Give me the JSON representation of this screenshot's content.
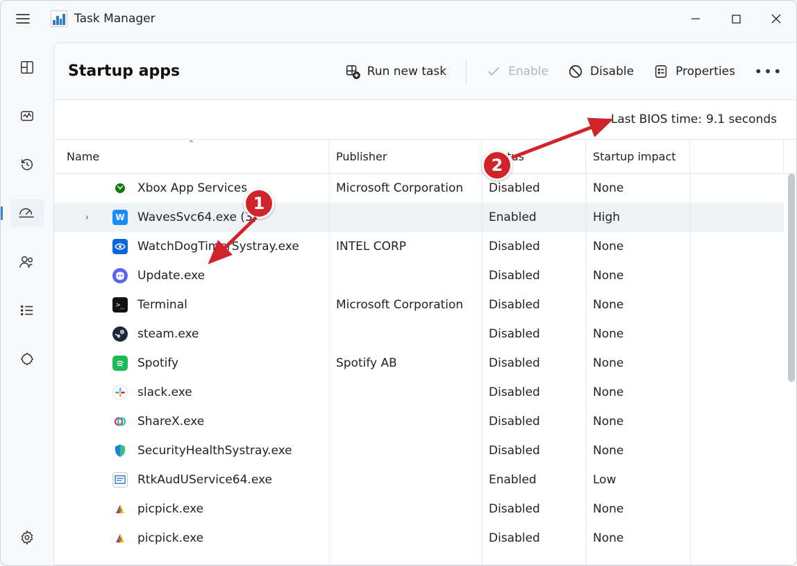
{
  "app": {
    "title": "Task Manager"
  },
  "page": {
    "title": "Startup apps"
  },
  "toolbar": {
    "run_new_task": "Run new task",
    "enable": "Enable",
    "disable": "Disable",
    "properties": "Properties"
  },
  "bios": {
    "label": "Last BIOS time:",
    "value": "9.1 seconds"
  },
  "columns": {
    "name": "Name",
    "publisher": "Publisher",
    "status": "Status",
    "impact": "Startup impact"
  },
  "rows": [
    {
      "name": "Xbox App Services",
      "publisher": "Microsoft Corporation",
      "status": "Disabled",
      "impact": "None",
      "icon": "xbox",
      "expandable": false
    },
    {
      "name": "WavesSvc64.exe (3)",
      "publisher": "",
      "status": "Enabled",
      "impact": "High",
      "icon": "waves",
      "expandable": true,
      "selected": true
    },
    {
      "name": "WatchDogTimerSystray.exe",
      "publisher": "INTEL CORP",
      "status": "Disabled",
      "impact": "None",
      "icon": "eye",
      "expandable": false
    },
    {
      "name": "Update.exe",
      "publisher": "",
      "status": "Disabled",
      "impact": "None",
      "icon": "discord",
      "expandable": false
    },
    {
      "name": "Terminal",
      "publisher": "Microsoft Corporation",
      "status": "Disabled",
      "impact": "None",
      "icon": "terminal",
      "expandable": false
    },
    {
      "name": "steam.exe",
      "publisher": "",
      "status": "Disabled",
      "impact": "None",
      "icon": "steam",
      "expandable": false
    },
    {
      "name": "Spotify",
      "publisher": "Spotify AB",
      "status": "Disabled",
      "impact": "None",
      "icon": "spotify",
      "expandable": false
    },
    {
      "name": "slack.exe",
      "publisher": "",
      "status": "Disabled",
      "impact": "None",
      "icon": "slack",
      "expandable": false
    },
    {
      "name": "ShareX.exe",
      "publisher": "",
      "status": "Disabled",
      "impact": "None",
      "icon": "sharex",
      "expandable": false
    },
    {
      "name": "SecurityHealthSystray.exe",
      "publisher": "",
      "status": "Disabled",
      "impact": "None",
      "icon": "shield",
      "expandable": false
    },
    {
      "name": "RtkAudUService64.exe",
      "publisher": "",
      "status": "Enabled",
      "impact": "Low",
      "icon": "generic",
      "expandable": false
    },
    {
      "name": "picpick.exe",
      "publisher": "",
      "status": "Disabled",
      "impact": "None",
      "icon": "picpick",
      "expandable": false
    },
    {
      "name": "picpick.exe",
      "publisher": "",
      "status": "Disabled",
      "impact": "None",
      "icon": "picpick",
      "expandable": false
    }
  ],
  "annotations": {
    "badge1": "1",
    "badge2": "2"
  }
}
